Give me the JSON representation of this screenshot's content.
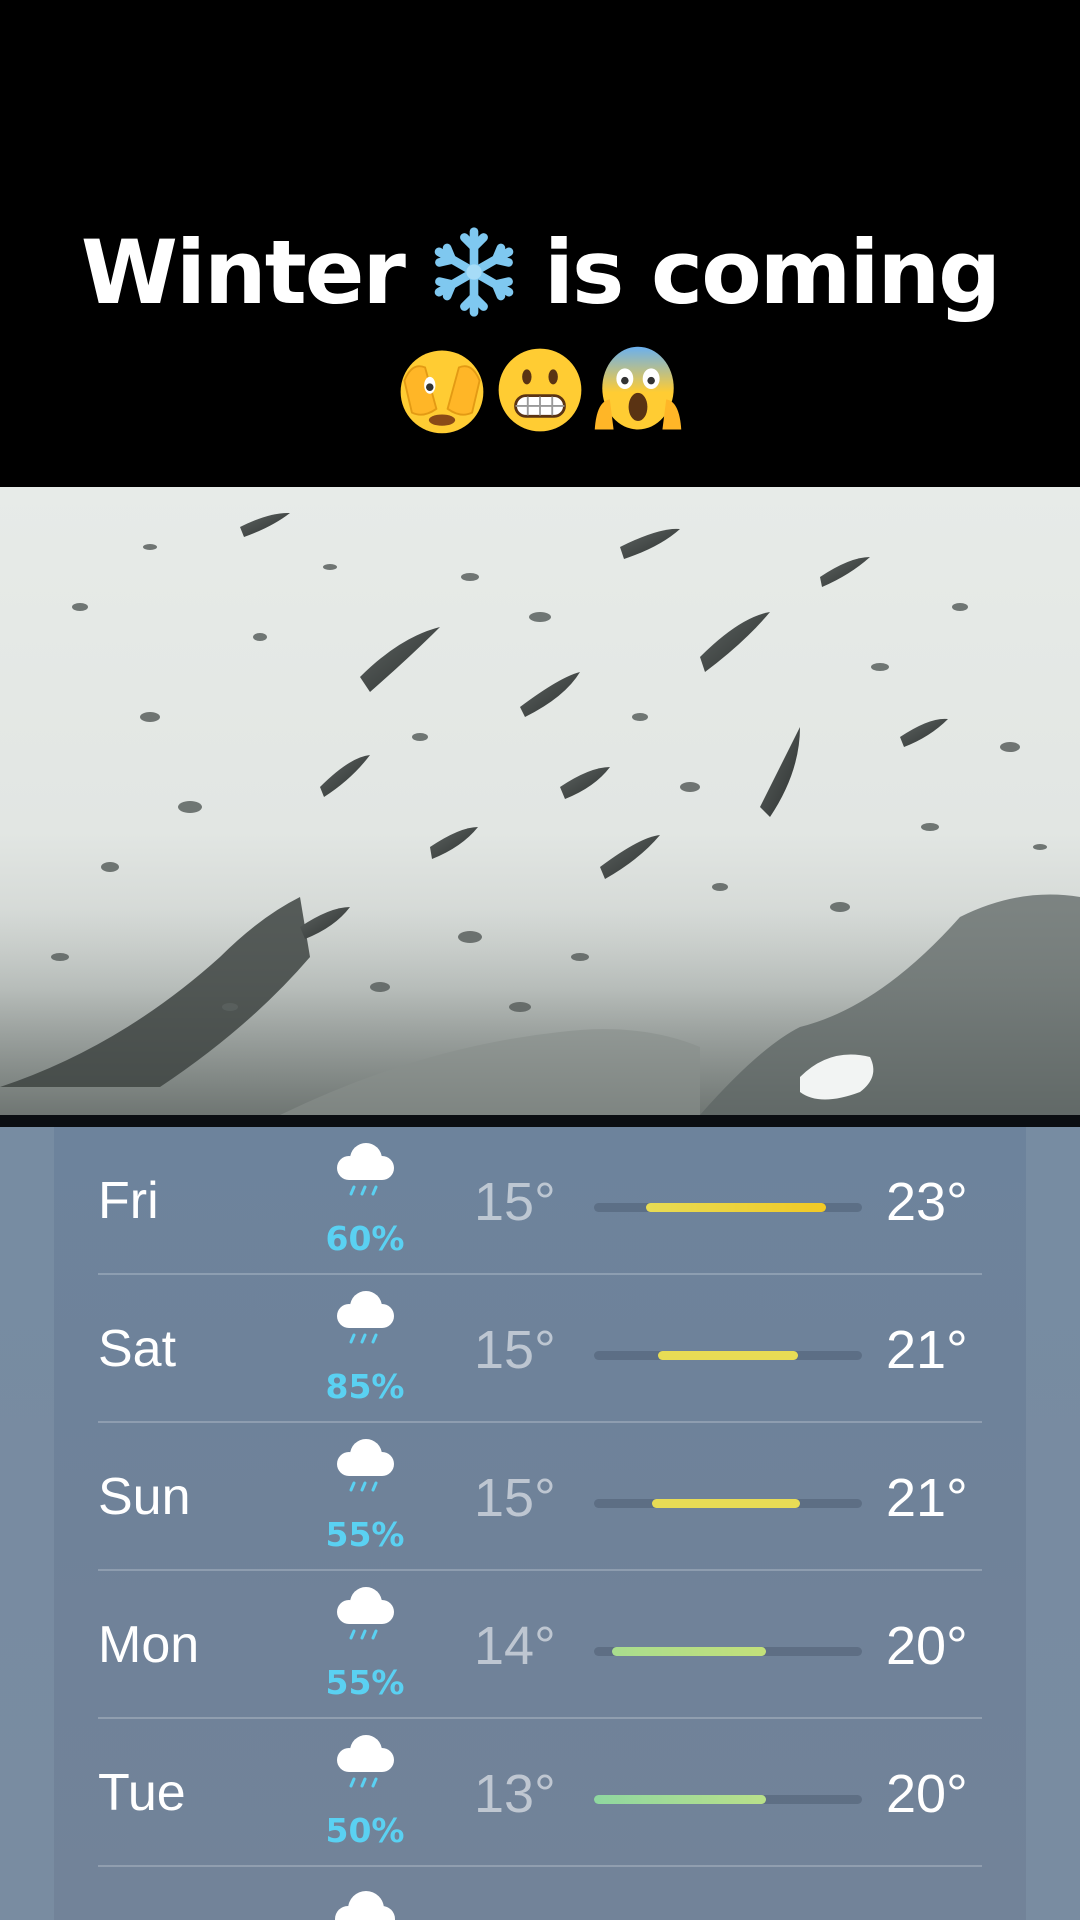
{
  "caption": {
    "line1_before": "Winter",
    "line1_after": "is coming",
    "snowflake_icon": "snowflake-icon",
    "emojis": [
      "face-with-peeking-eye-emoji",
      "grimacing-face-emoji",
      "face-screaming-in-fear-emoji"
    ]
  },
  "photo": {
    "subject": "rain-on-window-photo"
  },
  "forecast": {
    "colors": {
      "precip": "#5ad1f2",
      "warm": "#f2d83c",
      "cool": "#a9dd8e"
    },
    "rows": [
      {
        "day": "Fri",
        "precip": "60%",
        "low": "15°",
        "high": "23°"
      },
      {
        "day": "Sat",
        "precip": "85%",
        "low": "15°",
        "high": "21°"
      },
      {
        "day": "Sun",
        "precip": "55%",
        "low": "15°",
        "high": "21°"
      },
      {
        "day": "Mon",
        "precip": "55%",
        "low": "14°",
        "high": "20°"
      },
      {
        "day": "Tue",
        "precip": "50%",
        "low": "13°",
        "high": "20°"
      }
    ]
  }
}
